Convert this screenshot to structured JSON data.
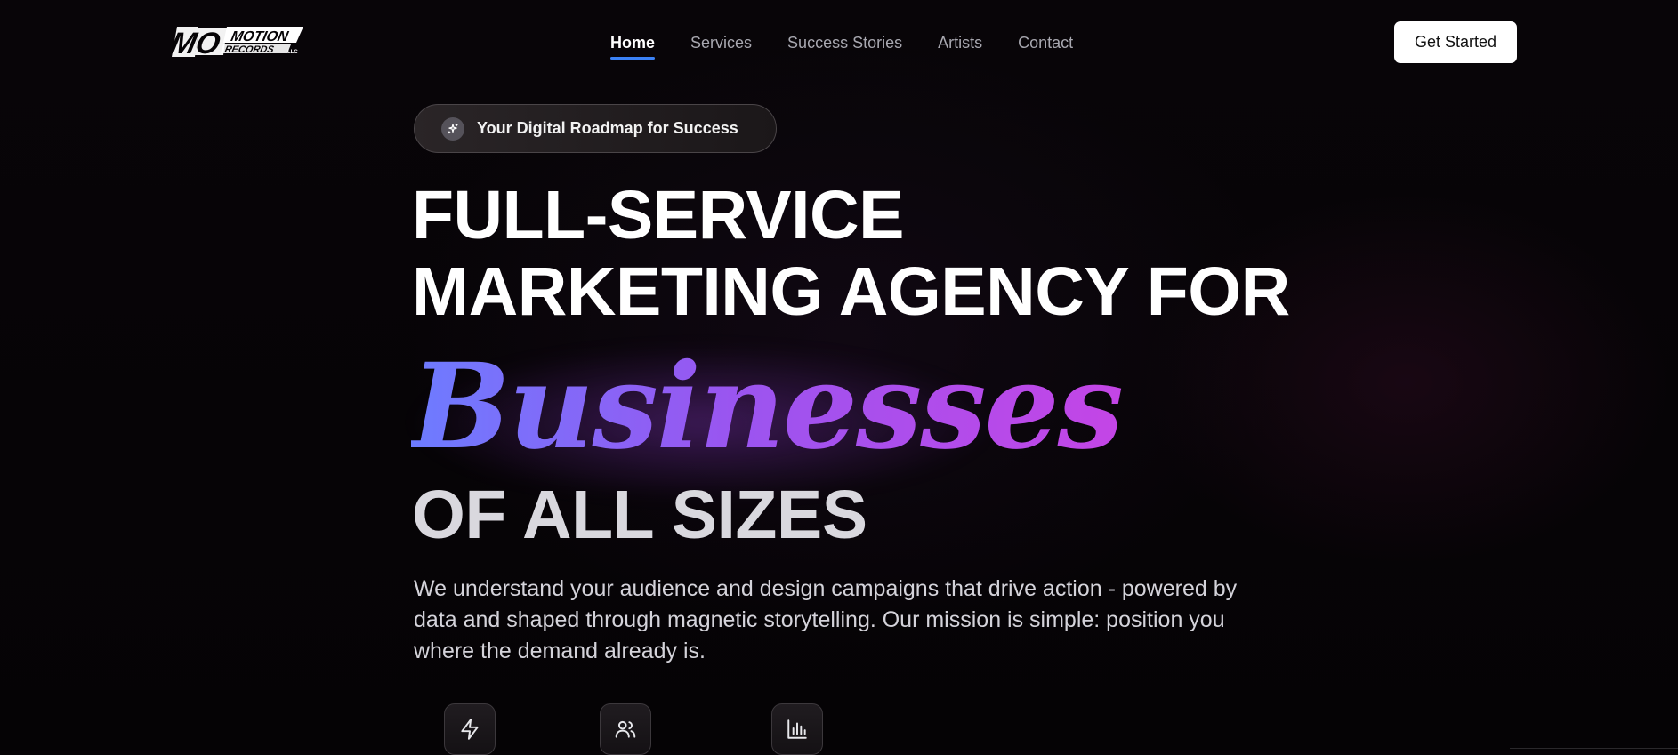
{
  "brand": {
    "logo_line1": "MOTION",
    "logo_line2": "RECORDS",
    "logo_suffix": "LLC"
  },
  "nav": {
    "items": [
      {
        "label": "Home",
        "active": true
      },
      {
        "label": "Services",
        "active": false
      },
      {
        "label": "Success Stories",
        "active": false
      },
      {
        "label": "Artists",
        "active": false
      },
      {
        "label": "Contact",
        "active": false
      }
    ],
    "cta_label": "Get Started"
  },
  "hero": {
    "badge_text": "Your Digital Roadmap for Success",
    "headline_line1": "FULL-SERVICE",
    "headline_line2": "MARKETING AGENCY FOR",
    "headline_highlight": "Businesses",
    "headline_line4": "OF ALL SIZES",
    "description": "We understand your audience and design campaigns that drive action - powered by data and shaped through magnetic storytelling. Our mission is simple: position you where the demand already is.",
    "feature_icons": [
      "lightning-icon",
      "users-icon",
      "bar-chart-icon"
    ]
  },
  "colors": {
    "background": "#060406",
    "nav_active_underline": "#3b82f6",
    "gradient_start": "#6d7cff",
    "gradient_mid": "#9a55f0",
    "gradient_end": "#c445e6"
  }
}
